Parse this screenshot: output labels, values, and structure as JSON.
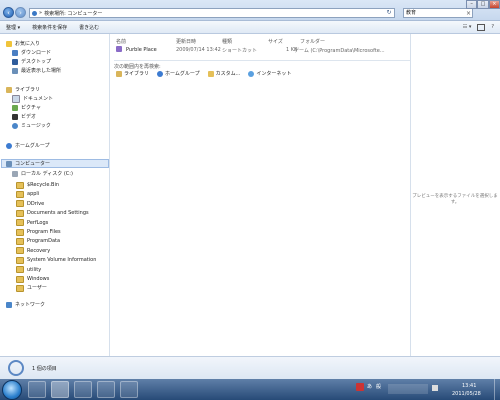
{
  "addressbar": {
    "path_icon_label": "»",
    "path": "検索場所: コンピューター",
    "refresh": "↻",
    "search_value": "教育",
    "search_clear": "×"
  },
  "window_controls": {
    "minimize": "–",
    "maximize": "□",
    "close": "×"
  },
  "toolbar": {
    "organize": "整理 ▾",
    "save_search": "検索条件を保存",
    "burn": "書き込む",
    "views": "☷ ▾",
    "help": "?"
  },
  "nav": {
    "favorites": "お気に入り",
    "downloads": "ダウンロード",
    "desktop": "デスクトップ",
    "recent": "最近表示した場所",
    "libraries": "ライブラリ",
    "documents": "ドキュメント",
    "pictures": "ピクチャ",
    "videos": "ビデオ",
    "music": "ミュージック",
    "homegroup": "ホームグループ",
    "computer": "コンピューター",
    "local_disk": "ローカル ディスク (C:)",
    "folders": [
      "$Recycle.Bin",
      "appli",
      "DDrive",
      "Documents and Settings",
      "PerfLogs",
      "Program Files",
      "ProgramData",
      "Recovery",
      "System Volume Information",
      "utility",
      "Windows",
      "ユーザー"
    ],
    "network": "ネットワーク"
  },
  "columns": {
    "name": "名前",
    "date": "更新日時",
    "type": "種類",
    "size": "サイズ",
    "folder": "フォルダー"
  },
  "results": [
    {
      "name": "Purble Place",
      "date": "2009/07/14 13:42",
      "type": "ショートカット",
      "size": "1 KB",
      "folder": "ゲーム (C:\\ProgramData\\Microsofte..."
    }
  ],
  "search_again": {
    "label": "次の範囲内を再検索:",
    "links": [
      "ライブラリ",
      "ホームグループ",
      "カスタム...",
      "インターネット"
    ]
  },
  "preview_text": "プレビューを表示するファイルを選択します。",
  "status_text": "1 個の項目",
  "tray": {
    "ime_a": "あ",
    "ime_kan": "般",
    "time": "13:41",
    "date": "2011/05/28"
  }
}
